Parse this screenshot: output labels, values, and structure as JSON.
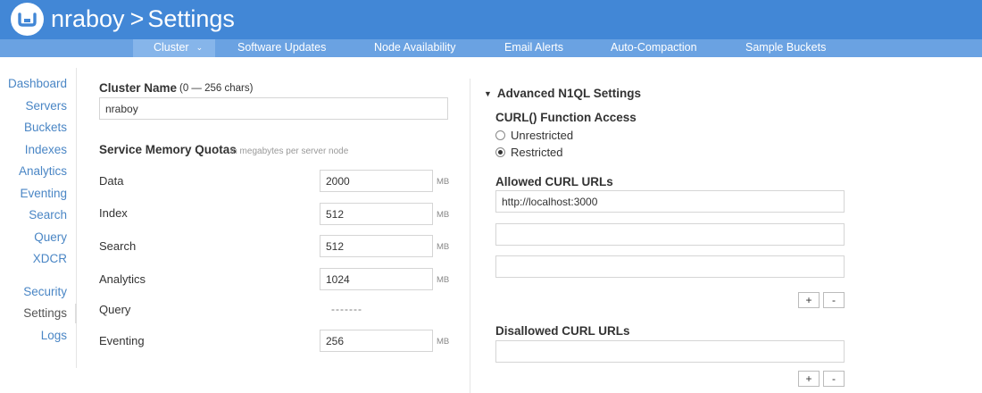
{
  "header": {
    "node_name": "nraboy",
    "separator": ">",
    "page_title": "Settings",
    "bg_color": "#4287d6"
  },
  "nav": {
    "items": [
      {
        "label": "Cluster",
        "caret": "⌄"
      },
      {
        "label": "Software Updates"
      },
      {
        "label": "Node Availability"
      },
      {
        "label": "Email Alerts"
      },
      {
        "label": "Auto-Compaction"
      },
      {
        "label": "Sample Buckets"
      }
    ]
  },
  "sidebar": {
    "items": [
      {
        "label": "Dashboard"
      },
      {
        "label": "Servers"
      },
      {
        "label": "Buckets"
      },
      {
        "label": "Indexes"
      },
      {
        "label": "Analytics"
      },
      {
        "label": "Eventing"
      },
      {
        "label": "Search"
      },
      {
        "label": "Query"
      },
      {
        "label": "XDCR"
      },
      {
        "label": "Security"
      },
      {
        "label": "Settings"
      },
      {
        "label": "Logs"
      }
    ],
    "current": "Settings"
  },
  "cluster": {
    "name_label": "Cluster Name",
    "name_hint": "(0 — 256 chars)",
    "name_value": "nraboy"
  },
  "quotas": {
    "title": "Service Memory Quotas",
    "hint": "in megabytes per server node",
    "unit": "MB",
    "rows": [
      {
        "label": "Data",
        "value": "2000"
      },
      {
        "label": "Index",
        "value": "512"
      },
      {
        "label": "Search",
        "value": "512"
      },
      {
        "label": "Analytics",
        "value": "1024"
      },
      {
        "label": "Query",
        "placeholder_dashes": "-------"
      },
      {
        "label": "Eventing",
        "value": "256"
      }
    ]
  },
  "n1ql": {
    "section_title": "Advanced N1QL Settings",
    "curl_access_label": "CURL() Function Access",
    "radio_unrestricted": "Unrestricted",
    "radio_restricted": "Restricted",
    "selected": "Restricted",
    "allowed_label": "Allowed CURL URLs",
    "allowed_urls": [
      "http://localhost:3000",
      "",
      ""
    ],
    "disallowed_label": "Disallowed CURL URLs",
    "disallowed_urls": [
      ""
    ],
    "add_label": "+",
    "remove_label": "-"
  }
}
